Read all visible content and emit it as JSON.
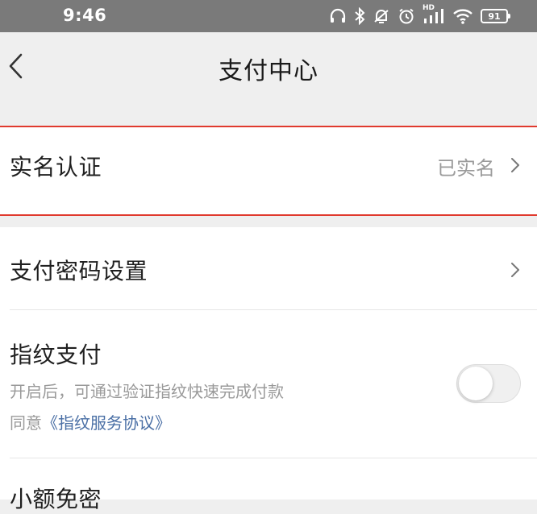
{
  "status_bar": {
    "time": "9:46",
    "network_badge": "HD",
    "battery": "91"
  },
  "header": {
    "title": "支付中心"
  },
  "realname": {
    "label": "实名认证",
    "value": "已实名"
  },
  "pay_password": {
    "label": "支付密码设置"
  },
  "fingerprint": {
    "label": "指纹支付",
    "description": "开启后，可通过验证指纹快速完成付款",
    "agree_prefix": "同意",
    "agreement_link": "《指纹服务协议》",
    "enabled": false
  },
  "small_amount": {
    "label": "小额免密"
  },
  "colors": {
    "highlight_border": "#e03a2e",
    "link": "#4a6fa5",
    "status_bar_bg": "#7a7a7a"
  }
}
